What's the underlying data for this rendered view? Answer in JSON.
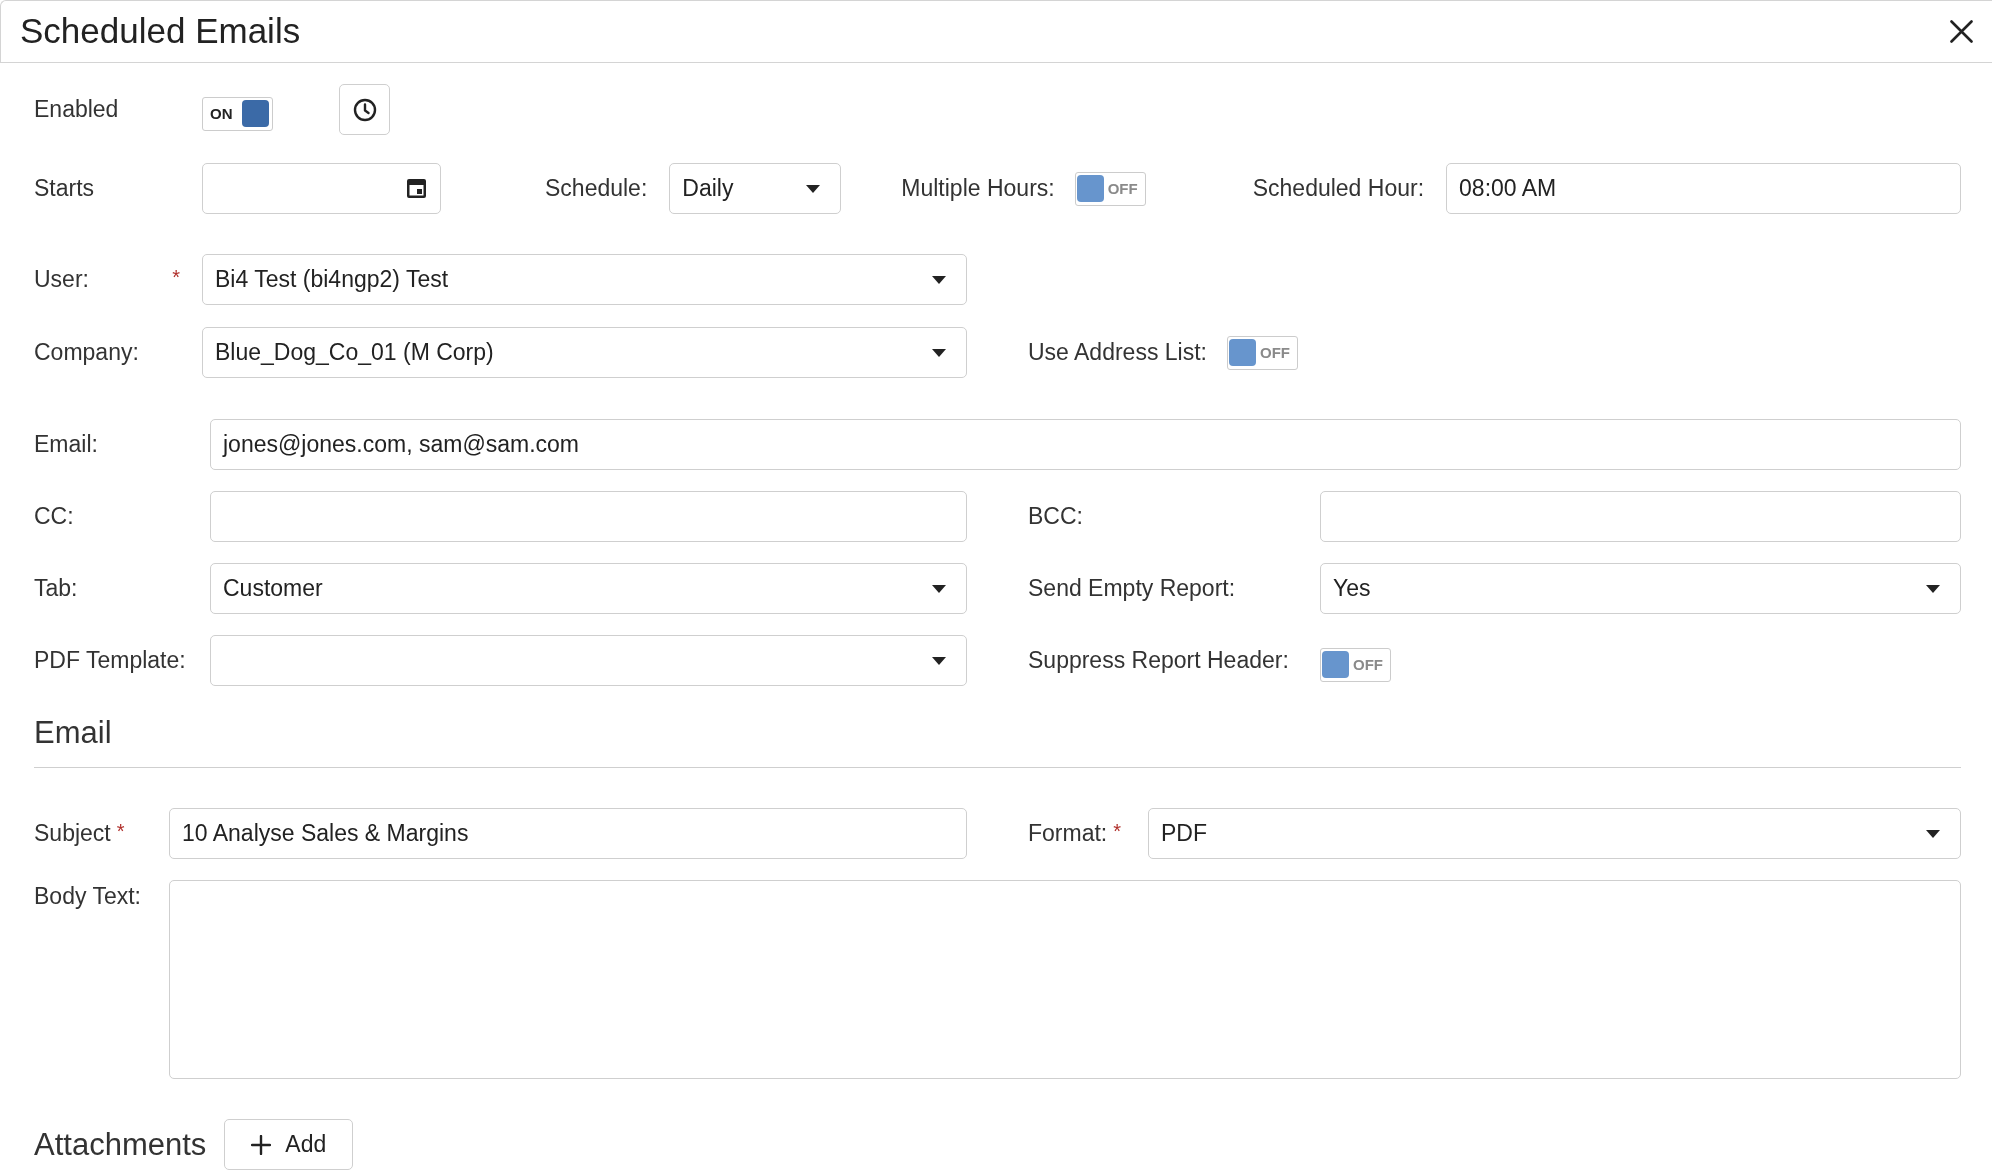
{
  "window": {
    "title": "Scheduled Emails"
  },
  "enabled": {
    "label": "Enabled",
    "switch": {
      "on": true,
      "text": "ON"
    }
  },
  "starts": {
    "label": "Starts"
  },
  "schedule": {
    "label": "Schedule:",
    "value": "Daily"
  },
  "multiple_hours": {
    "label": "Multiple Hours:",
    "switch": {
      "on": false,
      "text": "OFF"
    }
  },
  "scheduled_hour": {
    "label": "Scheduled Hour:",
    "value": "08:00 AM"
  },
  "user": {
    "label": "User:",
    "required_mark": "*",
    "value": "Bi4 Test (bi4ngp2) Test"
  },
  "company": {
    "label": "Company:",
    "value": "Blue_Dog_Co_01 (M Corp)"
  },
  "use_address_list": {
    "label": "Use Address List:",
    "switch": {
      "on": false,
      "text": "OFF"
    }
  },
  "email": {
    "label": "Email:",
    "value": "jones@jones.com, sam@sam.com"
  },
  "cc": {
    "label": "CC:"
  },
  "bcc": {
    "label": "BCC:"
  },
  "tab": {
    "label": "Tab:",
    "value": "Customer"
  },
  "send_empty_report": {
    "label": "Send Empty Report:",
    "value": "Yes"
  },
  "pdf_template": {
    "label": "PDF Template:"
  },
  "suppress_report_header": {
    "label": "Suppress Report Header:",
    "switch": {
      "on": false,
      "text": "OFF"
    }
  },
  "email_section": {
    "title": "Email",
    "subject": {
      "label": "Subject",
      "required_mark": "*",
      "value": "10 Analyse Sales & Margins"
    },
    "format": {
      "label": "Format:",
      "required_mark": "*",
      "value": "PDF"
    },
    "body_text": {
      "label": "Body Text:"
    }
  },
  "attachments": {
    "title": "Attachments",
    "add_button": {
      "label": "Add"
    }
  }
}
